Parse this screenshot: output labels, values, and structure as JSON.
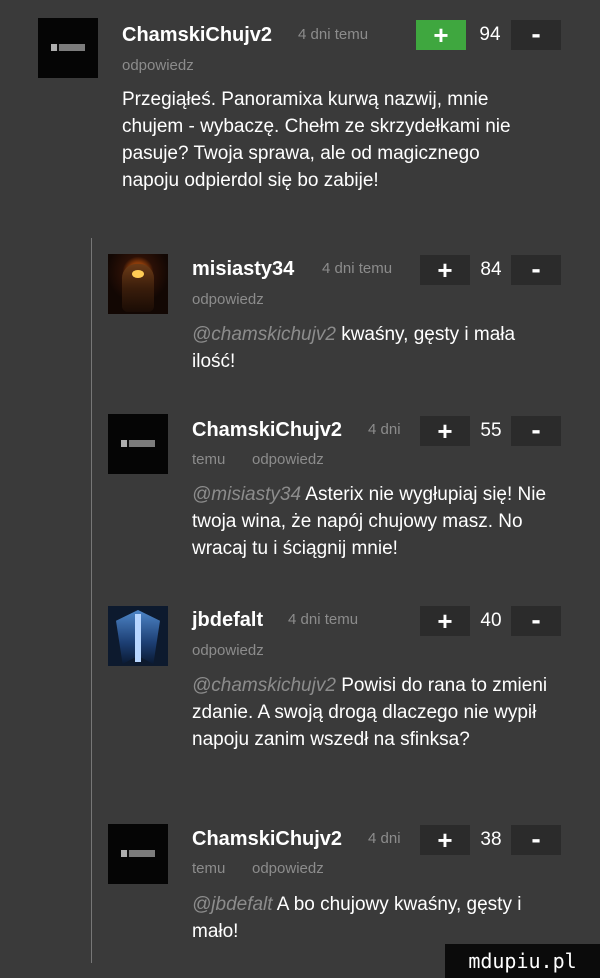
{
  "comments": [
    {
      "username": "ChamskiChujv2",
      "time": "4 dni temu",
      "reply": "odpowiedz",
      "score": "94",
      "plus": "+",
      "minus": "-",
      "mention": "",
      "text": "Przegiąłeś. Panoramixa kurwą nazwij, mnie chujem - wybaczę. Chełm ze skrzydełkami nie pasuje? Twoja sprawa, ale od magicznego napoju odpierdol się bo zabije!"
    },
    {
      "username": "misiasty34",
      "time": "4 dni temu",
      "reply": "odpowiedz",
      "score": "84",
      "plus": "+",
      "minus": "-",
      "mention": "@chamskichujv2",
      "text": "kwaśny, gęsty i mała ilość!"
    },
    {
      "username": "ChamskiChujv2",
      "time_part1": "4 dni",
      "time_part2": "temu",
      "reply": "odpowiedz",
      "score": "55",
      "plus": "+",
      "minus": "-",
      "mention": "@misiasty34",
      "text": "Asterix nie wygłupiaj się! Nie twoja wina, że napój chujowy masz. No wracaj tu i ściągnij mnie!"
    },
    {
      "username": "jbdefalt",
      "time": "4 dni temu",
      "reply": "odpowiedz",
      "score": "40",
      "plus": "+",
      "minus": "-",
      "mention": "@chamskichujv2",
      "text": "Powisi do rana to zmieni zdanie. A swoją drogą dlaczego nie wypił napoju zanim wszedł na sfinksa?"
    },
    {
      "username": "ChamskiChujv2",
      "time_part1": "4 dni",
      "time_part2": "temu",
      "reply": "odpowiedz",
      "score": "38",
      "plus": "+",
      "minus": "-",
      "mention": "@jbdefalt",
      "text": "A bo chujowy kwaśny, gęsty i mało!"
    }
  ],
  "watermark": "mdupiu.pl",
  "colors": {
    "background": "#3a3a3a",
    "vote_button": "#2b2b2b",
    "plus_active": "#3fa73f",
    "muted": "#8c8c8c"
  }
}
